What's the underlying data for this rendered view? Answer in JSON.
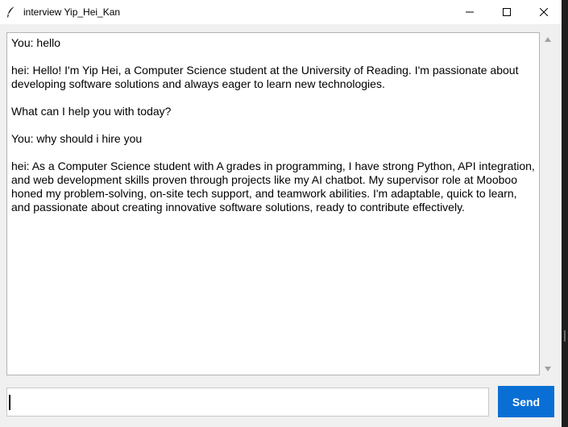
{
  "window": {
    "title": "interview Yip_Hei_Kan",
    "icon": "feather-icon",
    "controls": [
      "minimize-icon",
      "maximize-icon",
      "close-icon"
    ]
  },
  "chat": {
    "messages": [
      {
        "text": "You: hello"
      },
      {
        "text": "hei: Hello! I'm Yip Hei, a Computer Science student at the University of Reading. I'm passionate about developing software solutions and always eager to learn new technologies."
      },
      {
        "text": "What can I help you with today?"
      },
      {
        "text": "You: why should i hire you"
      },
      {
        "text": "hei: As a Computer Science student with A grades in programming, I have strong Python, API integration, and web development skills proven through projects like my AI chatbot. My supervisor role at Mooboo honed my problem-solving, on-site tech support, and teamwork abilities. I'm adaptable, quick to learn, and passionate about creating innovative software solutions, ready to contribute effectively."
      }
    ]
  },
  "input": {
    "value": "",
    "placeholder": ""
  },
  "send_button": {
    "label": "Send"
  },
  "colors": {
    "accent": "#0a6fd4",
    "window_bg": "#f0f0f0",
    "text_bg": "#ffffff"
  }
}
